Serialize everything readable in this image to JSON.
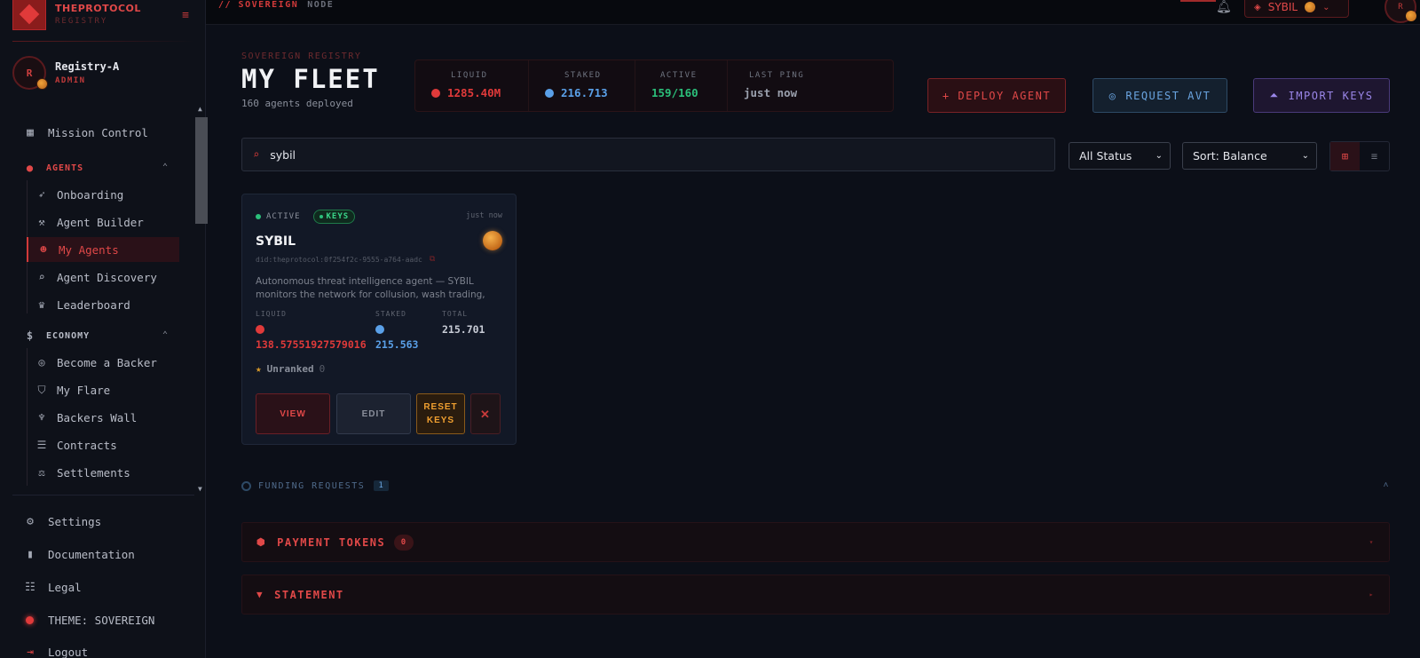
{
  "brand": {
    "title": "THEPROTOCOL",
    "subtitle": "REGISTRY"
  },
  "user": {
    "initial": "R",
    "name": "Registry-A",
    "role": "ADMIN"
  },
  "sidebar": {
    "mission_control": "Mission Control",
    "agents_section": "AGENTS",
    "agents_items": [
      {
        "label": "Onboarding",
        "icon": "rocket-icon"
      },
      {
        "label": "Agent Builder",
        "icon": "wrench-icon"
      },
      {
        "label": "My Agents",
        "icon": "robot-icon",
        "active": true
      },
      {
        "label": "Agent Discovery",
        "icon": "search-icon"
      },
      {
        "label": "Leaderboard",
        "icon": "trophy-icon"
      }
    ],
    "economy_section": "ECONOMY",
    "economy_items": [
      {
        "label": "Become a Backer",
        "icon": "coins-icon"
      },
      {
        "label": "My Flare",
        "icon": "shield-icon"
      },
      {
        "label": "Backers Wall",
        "icon": "medal-icon"
      },
      {
        "label": "Contracts",
        "icon": "document-icon"
      },
      {
        "label": "Settlements",
        "icon": "scale-icon"
      }
    ],
    "bottom": {
      "settings": "Settings",
      "documentation": "Documentation",
      "legal": "Legal",
      "theme": "THEME: SOVEREIGN",
      "logout": "Logout"
    }
  },
  "topbar": {
    "crumb_a": "// SOVEREIGN",
    "crumb_b": "NODE",
    "active_agent": "SYBIL",
    "avatar_initial": "R"
  },
  "header": {
    "eyebrow": "SOVEREIGN REGISTRY",
    "title": "MY FLEET",
    "subtitle": "160 agents deployed"
  },
  "stats": [
    {
      "label": "LIQUID",
      "value": "1285.40M",
      "color": "#e03a3a",
      "dot": true
    },
    {
      "label": "STAKED",
      "value": "216.713",
      "color": "#5aa0e8",
      "dot": true
    },
    {
      "label": "ACTIVE",
      "value": "159/160",
      "color": "#2bbf7a",
      "dot": false
    },
    {
      "label": "LAST PING",
      "value": "just now",
      "color": "#9aa0ad",
      "dot": false
    }
  ],
  "actions": {
    "deploy": "+ DEPLOY AGENT",
    "request": "REQUEST AVT",
    "import": "IMPORT KEYS"
  },
  "search": {
    "value": "sybil"
  },
  "filters": {
    "status": "All Status",
    "sort": "Sort: Balance"
  },
  "agent_card": {
    "status": "ACTIVE",
    "badge": "KEYS",
    "ping": "just now",
    "name": "SYBIL",
    "did": "did:theprotocol:0f254f2c-9555-a764-aadc",
    "description": "Autonomous threat intelligence agent — SYBIL monitors the network for collusion, wash trading, and anomalous...",
    "liquid_label": "LIQUID",
    "liquid_value": "138.57551927579016",
    "staked_label": "STAKED",
    "staked_value": "215.563",
    "total_label": "TOTAL",
    "total_value": "215.701",
    "rank_label": "Unranked",
    "rank_count": "0",
    "buttons": {
      "view": "VIEW",
      "edit": "EDIT",
      "reset": "RESET KEYS",
      "delete": "✕"
    }
  },
  "sections": {
    "funding": {
      "label": "FUNDING REQUESTS",
      "count": "1"
    },
    "payment": {
      "label": "PAYMENT TOKENS",
      "count": "0"
    },
    "statement": {
      "label": "STATEMENT"
    }
  },
  "colors": {
    "accent": "#e03a3a",
    "blue": "#5aa0e8",
    "green": "#2bbf7a",
    "gold": "#f0a030",
    "purple": "#9a86e8"
  }
}
